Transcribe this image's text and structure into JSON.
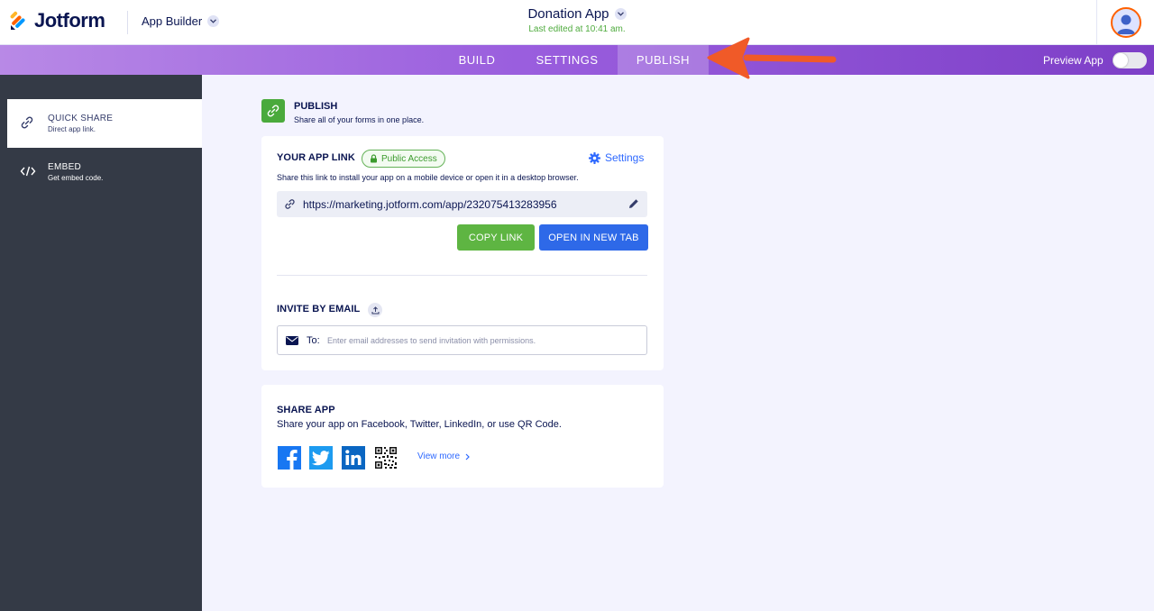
{
  "header": {
    "logo_text": "Jotform",
    "app_builder_label": "App Builder",
    "app_title": "Donation App",
    "last_edited": "Last edited at 10:41 am."
  },
  "nav": {
    "tabs": [
      {
        "label": "BUILD",
        "active": false
      },
      {
        "label": "SETTINGS",
        "active": false
      },
      {
        "label": "PUBLISH",
        "active": true
      }
    ],
    "preview_label": "Preview App",
    "preview_enabled": false
  },
  "sidebar": {
    "items": [
      {
        "title": "QUICK SHARE",
        "subtitle": "Direct app link.",
        "icon": "link-icon",
        "active": true
      },
      {
        "title": "EMBED",
        "subtitle": "Get embed code.",
        "icon": "code-icon",
        "active": false
      }
    ]
  },
  "publish": {
    "title": "PUBLISH",
    "subtitle": "Share all of your forms in one place."
  },
  "app_link": {
    "title": "YOUR APP LINK",
    "badge": "Public Access",
    "settings_label": "Settings",
    "description": "Share this link to install your app on a mobile device or open it in a desktop browser.",
    "url": "https://marketing.jotform.com/app/232075413283956",
    "copy_label": "COPY LINK",
    "open_label": "OPEN IN NEW TAB"
  },
  "invite": {
    "title": "INVITE BY EMAIL",
    "to_label": "To:",
    "placeholder": "Enter email addresses to send invitation with permissions."
  },
  "share": {
    "title": "SHARE APP",
    "description": "Share your app on Facebook, Twitter, LinkedIn, or use QR Code.",
    "view_more": "View more"
  },
  "colors": {
    "accent_green": "#5eb542",
    "accent_blue": "#2e69e8",
    "nav_purple": "#9a5ede",
    "sidebar_dark": "#343a46",
    "annotation_arrow": "#f05a28"
  }
}
